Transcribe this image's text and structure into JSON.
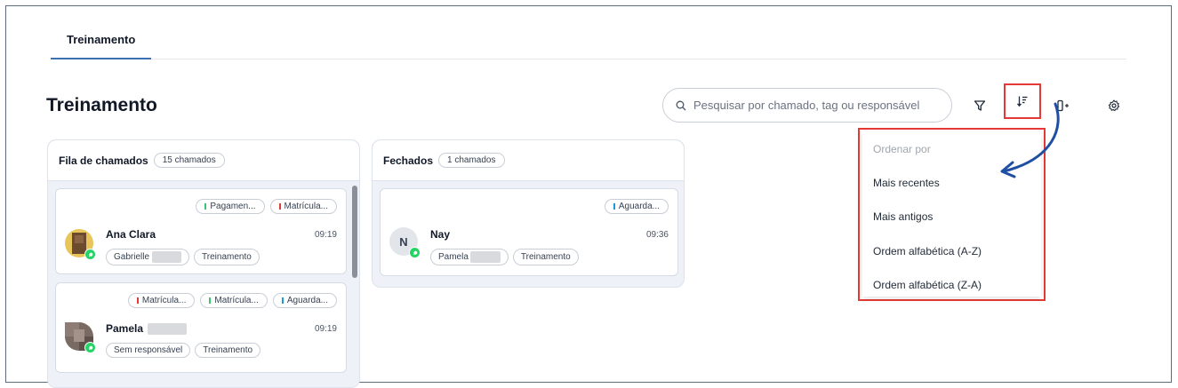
{
  "tabs": [
    {
      "label": "Treinamento",
      "active": true
    }
  ],
  "page": {
    "title": "Treinamento"
  },
  "search": {
    "placeholder": "Pesquisar por chamado, tag ou responsável"
  },
  "toolbar": {
    "icons": [
      "filter-icon",
      "sort-icon",
      "add-panel-icon",
      "gear-icon"
    ]
  },
  "columns": [
    {
      "title": "Fila de chamados",
      "count": "15 chamados",
      "cards": [
        {
          "tags": [
            {
              "label": "Pagamen...",
              "color": "#3ec46d"
            },
            {
              "label": "Matrícula...",
              "color": "#e53935"
            }
          ],
          "name": "Ana Clara",
          "time": "09:19",
          "chips": [
            "Gabrielle",
            "Treinamento"
          ]
        },
        {
          "tags": [
            {
              "label": "Matrícula...",
              "color": "#e53935"
            },
            {
              "label": "Matrícula...",
              "color": "#3ec46d"
            },
            {
              "label": "Aguarda...",
              "color": "#1e9bd7"
            }
          ],
          "name": "Pamela",
          "time": "09:19",
          "chips": [
            "Sem responsável",
            "Treinamento"
          ]
        }
      ]
    },
    {
      "title": "Fechados",
      "count": "1 chamados",
      "cards": [
        {
          "tags": [
            {
              "label": "Aguarda...",
              "color": "#1e9bd7"
            }
          ],
          "avatar_letter": "N",
          "name": "Nay",
          "time": "09:36",
          "chips": [
            "Pamela",
            "Treinamento"
          ]
        }
      ]
    }
  ],
  "sort_menu": {
    "header": "Ordenar por",
    "options": [
      "Mais recentes",
      "Mais antigos",
      "Ordem alfabética (A-Z)",
      "Ordem alfabética (Z-A)"
    ]
  },
  "colors": {
    "accent": "#3f6fb5",
    "highlight": "#e53935",
    "whatsapp": "#25d366",
    "arrow": "#1f4fa3"
  }
}
